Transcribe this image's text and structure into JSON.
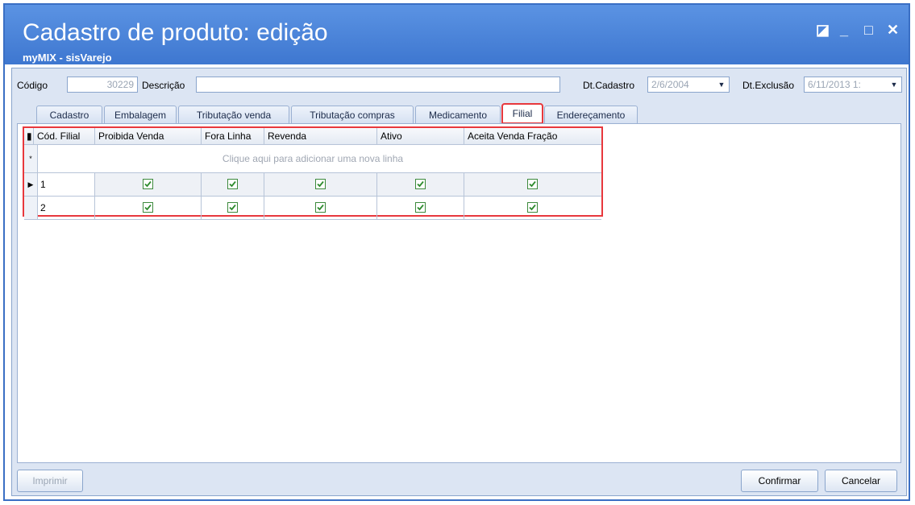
{
  "window": {
    "title": "Cadastro de produto: edição",
    "subtitle": "myMIX - sisVarejo",
    "controls": {
      "restore": "◪",
      "minimize": "_",
      "maximize": "□",
      "close": "✕"
    }
  },
  "form": {
    "codigo_label": "Código",
    "codigo_value": "30229",
    "descricao_label": "Descrição",
    "descricao_value": "",
    "dt_cadastro_label": "Dt.Cadastro",
    "dt_cadastro_value": "2/6/2004",
    "dt_exclusao_label": "Dt.Exclusão",
    "dt_exclusao_value": "6/11/2013 1:"
  },
  "tabs": [
    {
      "label": "Cadastro"
    },
    {
      "label": "Embalagem"
    },
    {
      "label": "Tributação venda"
    },
    {
      "label": "Tributação compras"
    },
    {
      "label": "Medicamento"
    },
    {
      "label": "Filial"
    },
    {
      "label": "Endereçamento"
    }
  ],
  "active_tab": "Filial",
  "grid": {
    "columns": [
      "Cód. Filial",
      "Proibida Venda",
      "Fora Linha",
      "Revenda",
      "Ativo",
      "Aceita Venda Fração"
    ],
    "add_row_text": "Clique aqui para adicionar uma nova linha",
    "rows": [
      {
        "cod": "1",
        "proibida_venda": true,
        "fora_linha": true,
        "revenda": true,
        "ativo": true,
        "aceita_venda_fracao": true
      },
      {
        "cod": "2",
        "proibida_venda": true,
        "fora_linha": true,
        "revenda": true,
        "ativo": true,
        "aceita_venda_fracao": true
      }
    ]
  },
  "buttons": {
    "imprimir": "Imprimir",
    "confirmar": "Confirmar",
    "cancelar": "Cancelar"
  },
  "colors": {
    "title_bar": "#4a85d8",
    "highlight": "#e8383d",
    "check": "#2e8b2e"
  }
}
